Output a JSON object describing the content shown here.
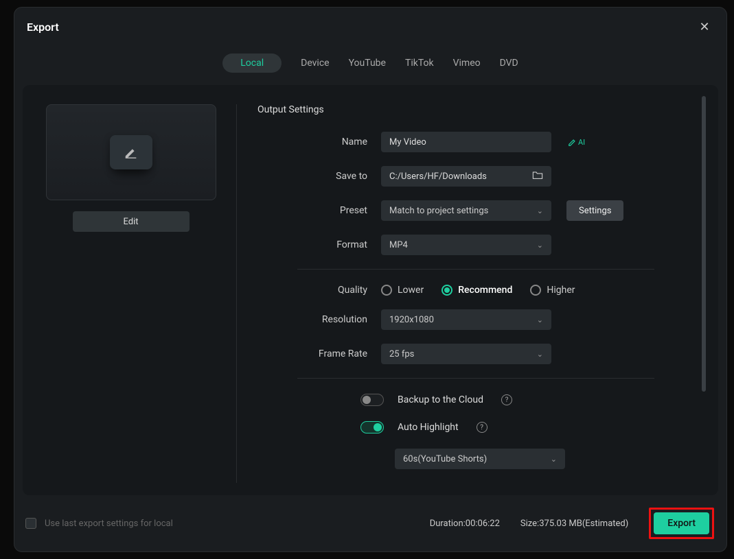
{
  "modal_title": "Export",
  "tabs": [
    "Local",
    "Device",
    "YouTube",
    "TikTok",
    "Vimeo",
    "DVD"
  ],
  "active_tab": 0,
  "edit_label": "Edit",
  "section_title": "Output Settings",
  "labels": {
    "name": "Name",
    "save_to": "Save to",
    "preset": "Preset",
    "format": "Format",
    "quality": "Quality",
    "resolution": "Resolution",
    "frame_rate": "Frame Rate"
  },
  "values": {
    "name": "My Video",
    "save_to": "C:/Users/HF/Downloads",
    "preset": "Match to project settings",
    "format": "MP4",
    "resolution": "1920x1080",
    "frame_rate": "25 fps",
    "highlight_preset": "60s(YouTube Shorts)"
  },
  "ai_badge": "AI",
  "settings_btn": "Settings",
  "quality_options": [
    "Lower",
    "Recommend",
    "Higher"
  ],
  "quality_selected": 1,
  "toggles": {
    "backup": {
      "label": "Backup to the Cloud",
      "on": false
    },
    "highlight": {
      "label": "Auto Highlight",
      "on": true
    }
  },
  "footer": {
    "use_last": "Use last export settings for local",
    "duration_label": "Duration:",
    "duration_value": "00:06:22",
    "size_label": "Size:",
    "size_value": "375.03 MB(Estimated)",
    "export_label": "Export"
  }
}
